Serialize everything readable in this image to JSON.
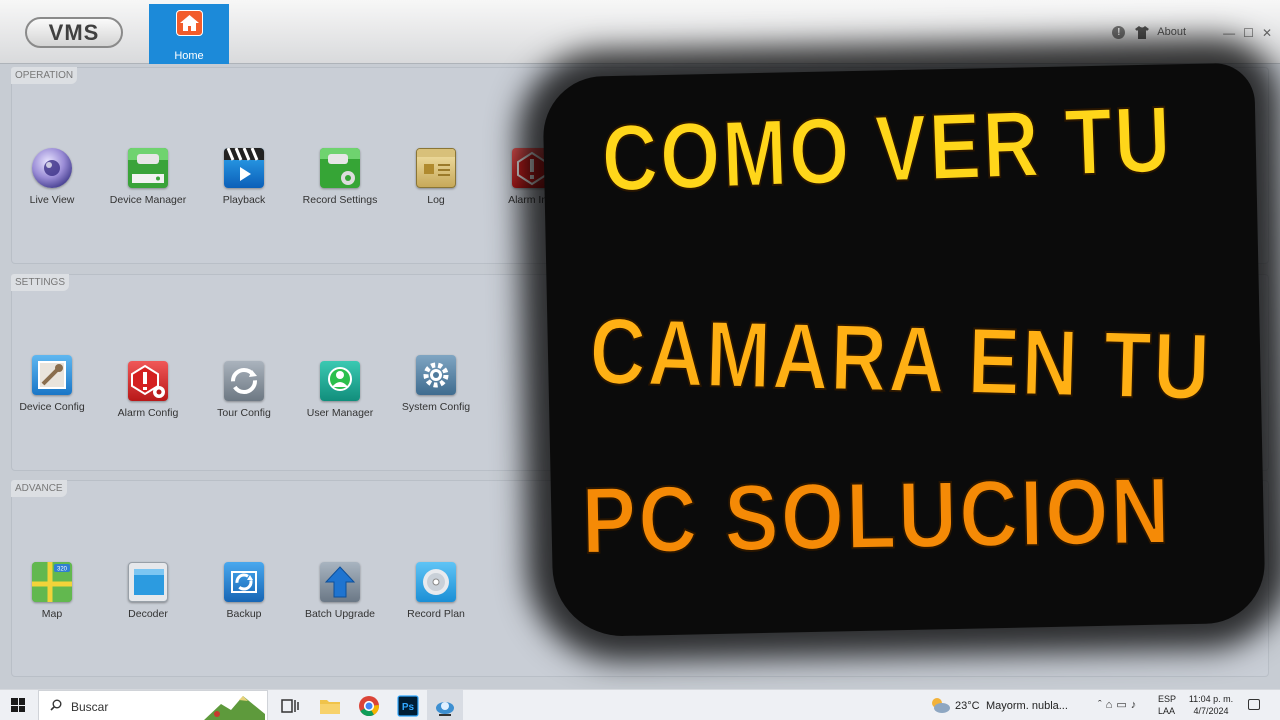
{
  "app": {
    "logo_text": "VMS",
    "home_tab_label": "Home",
    "about_label": "About",
    "window_controls": {
      "minimize": "—",
      "maximize": "☐",
      "close": "✕"
    }
  },
  "operation": {
    "title": "OPERATION",
    "items": [
      {
        "label": "Live View",
        "icon": "live-view-icon"
      },
      {
        "label": "Device Manager",
        "icon": "device-manager-icon"
      },
      {
        "label": "Playback",
        "icon": "playback-icon"
      },
      {
        "label": "Record Settings",
        "icon": "record-settings-icon"
      },
      {
        "label": "Log",
        "icon": "log-icon"
      },
      {
        "label": "Alarm Info",
        "icon": "alarm-info-icon"
      }
    ]
  },
  "settings": {
    "title": "SETTINGS",
    "items": [
      {
        "label": "Device Config",
        "icon": "device-config-icon"
      },
      {
        "label": "Alarm Config",
        "icon": "alarm-config-icon"
      },
      {
        "label": "Tour Config",
        "icon": "tour-config-icon"
      },
      {
        "label": "User Manager",
        "icon": "user-manager-icon"
      },
      {
        "label": "System Config",
        "icon": "system-config-icon"
      }
    ]
  },
  "advance": {
    "title": "ADVANCE",
    "items": [
      {
        "label": "Map",
        "icon": "map-icon"
      },
      {
        "label": "Decoder",
        "icon": "decoder-icon"
      },
      {
        "label": "Backup",
        "icon": "backup-icon"
      },
      {
        "label": "Batch Upgrade",
        "icon": "batch-upgrade-icon"
      },
      {
        "label": "Record Plan",
        "icon": "record-plan-icon"
      }
    ]
  },
  "banner": {
    "line1": "COMO VER TU",
    "line2": "CAMARA EN TU",
    "line3": "PC SOLUCION"
  },
  "taskbar": {
    "search_placeholder": "Buscar",
    "weather_temp": "23°C",
    "weather_condition": "Mayorm. nubla...",
    "language_1": "ESP",
    "language_2": "LAA",
    "time": "11:04 p. m.",
    "date": "4/7/2024",
    "map_badge": "320"
  },
  "colors": {
    "accent_blue": "#1c8ad9",
    "home_icon_orange": "#f25c2b",
    "banner_yellow": "#ffd61a",
    "banner_orange": "#f58a06",
    "panel_bg": "#c9ced6"
  }
}
